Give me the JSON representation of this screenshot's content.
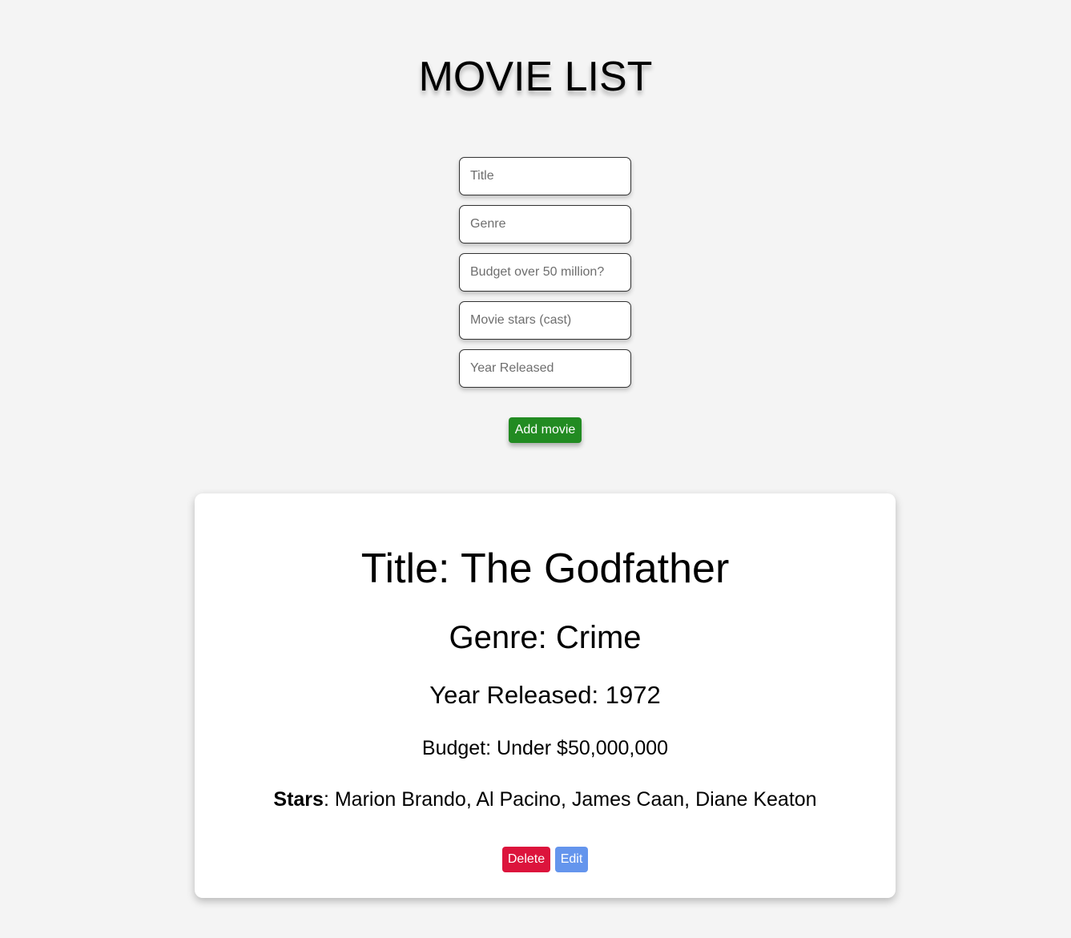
{
  "header": {
    "title": "MOVIE LIST"
  },
  "form": {
    "fields": [
      {
        "name": "title",
        "placeholder": "Title",
        "value": ""
      },
      {
        "name": "genre",
        "placeholder": "Genre",
        "value": ""
      },
      {
        "name": "budget",
        "placeholder": "Budget over 50 million?",
        "value": ""
      },
      {
        "name": "cast",
        "placeholder": "Movie stars (cast)",
        "value": ""
      },
      {
        "name": "year",
        "placeholder": "Year Released",
        "value": ""
      }
    ],
    "submit_label": "Add movie"
  },
  "movies": [
    {
      "title_line": "Title: The Godfather",
      "genre_line": "Genre: Crime",
      "year_line": "Year Released: 1972",
      "budget_line": "Budget: Under $50,000,000",
      "stars_key": "Stars",
      "stars_value": ": Marion Brando, Al Pacino, James Caan, Diane Keaton",
      "delete_label": "Delete",
      "edit_label": "Edit"
    }
  ],
  "colors": {
    "background": "#f4f4f4",
    "card": "#ffffff",
    "add_button": "#228b22",
    "delete_button": "#dc143c",
    "edit_button": "#6495ed"
  }
}
